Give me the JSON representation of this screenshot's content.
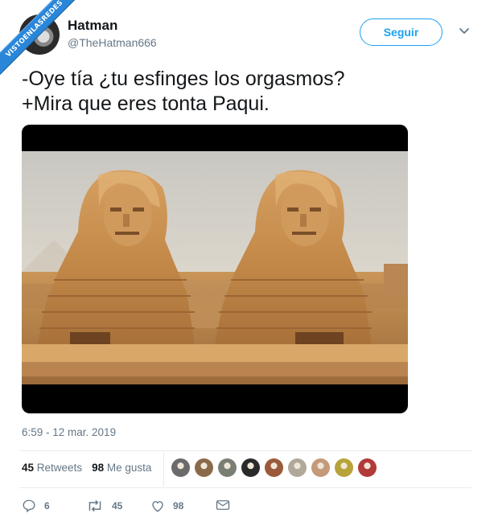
{
  "watermark": "VISTOENLASREDES",
  "tweet": {
    "display_name": "Hatman",
    "handle": "@TheHatman666",
    "follow_label": "Seguir",
    "text": "-Oye tía ¿tu esfinges los orgasmos?\n+Mira que eres tonta Paqui.",
    "timestamp": "6:59 - 12 mar. 2019"
  },
  "stats": {
    "retweets_count": "45",
    "retweets_label": "Retweets",
    "likes_count": "98",
    "likes_label": "Me gusta"
  },
  "likers": [
    {
      "icon": "liker-avatar-1",
      "color": "#6b6b6b"
    },
    {
      "icon": "liker-avatar-2",
      "color": "#8a6a4a"
    },
    {
      "icon": "liker-avatar-3",
      "color": "#7a7f73"
    },
    {
      "icon": "liker-avatar-4",
      "color": "#2a2a2a"
    },
    {
      "icon": "liker-avatar-5",
      "color": "#9b5a3a"
    },
    {
      "icon": "liker-avatar-6",
      "color": "#b0a89a"
    },
    {
      "icon": "liker-avatar-7",
      "color": "#c49a7a"
    },
    {
      "icon": "liker-avatar-8",
      "color": "#b7a33a"
    },
    {
      "icon": "liker-avatar-9",
      "color": "#b23a3a"
    }
  ],
  "actions": {
    "reply_count": "6",
    "retweet_count": "45",
    "like_count": "98"
  },
  "colors": {
    "accent": "#1da1f2",
    "secondary_text": "#657786",
    "primary_text": "#14171a",
    "watermark_blue": "#2a86d8"
  }
}
